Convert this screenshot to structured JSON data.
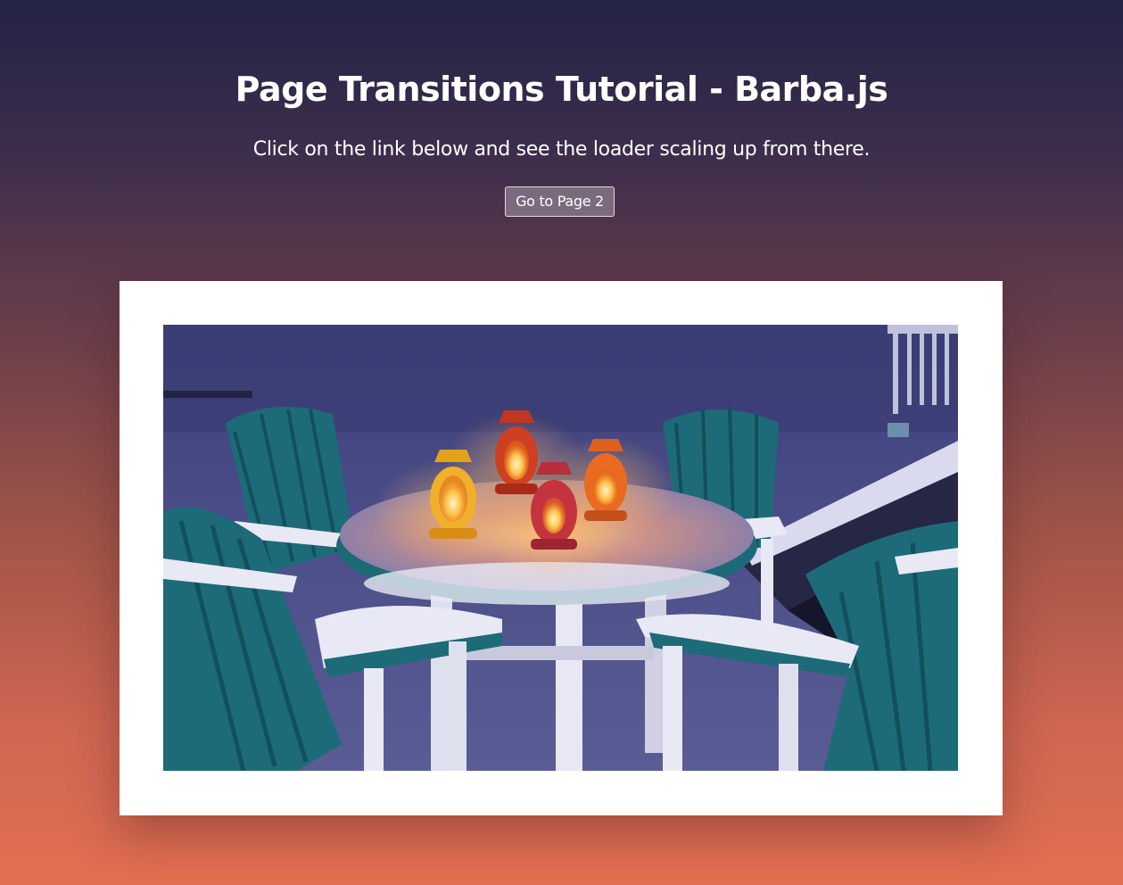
{
  "page": {
    "title": "Page Transitions Tutorial - Barba.js",
    "subtitle": "Click on the link below and see the loader scaling up from there.",
    "link_label": "Go to Page 2"
  },
  "image": {
    "subject": "snow-covered patio table with four lanterns and teal chairs at dusk"
  },
  "colors": {
    "gradient_top": "#232345",
    "gradient_bottom": "#e26f52",
    "frame": "#ffffff"
  }
}
